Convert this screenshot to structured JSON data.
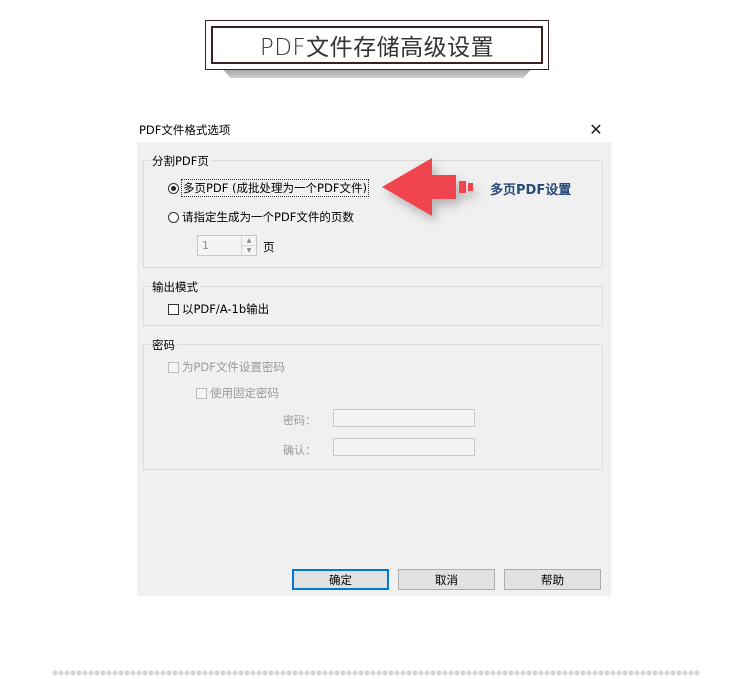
{
  "banner": {
    "title": "PDF文件存储高级设置"
  },
  "dialog": {
    "title": "PDF文件格式选项",
    "split_group": {
      "label": "分割PDF页",
      "option_multi": "多页PDF (成批处理为一个PDF文件)",
      "option_specify": "请指定生成为一个PDF文件的页数",
      "pages_value": "1",
      "pages_unit": "页",
      "selected": "option_multi"
    },
    "output_group": {
      "label": "输出模式",
      "pdfa_label": "以PDF/A-1b输出",
      "pdfa_checked": false
    },
    "password_group": {
      "label": "密码",
      "set_password_label": "为PDF文件设置密码",
      "fixed_password_label": "使用固定密码",
      "password_label": "密码：",
      "confirm_label": "确认："
    },
    "buttons": {
      "ok": "确定",
      "cancel": "取消",
      "help": "帮助"
    }
  },
  "annotation": {
    "text": "多页PDF设置",
    "color": "#f0454f"
  }
}
